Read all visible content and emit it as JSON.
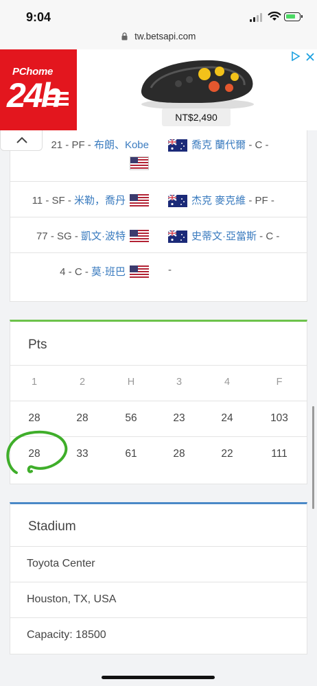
{
  "status": {
    "time": "9:04"
  },
  "browser": {
    "url": "tw.betsapi.com"
  },
  "ad": {
    "brand_top": "PChome",
    "brand_big": "24h",
    "price": "NT$2,490",
    "choices_icon": "ad-choices-icon",
    "close_icon": "close-icon"
  },
  "lineup": {
    "rows": [
      {
        "home_prefix": "21 - PF - ",
        "home_name": "布朗、Kobe",
        "away_name": "喬克 蘭代爾",
        "away_suffix": " - C -"
      },
      {
        "home_prefix": "11 - SF - ",
        "home_name": "米勒，喬丹",
        "away_name": "杰克 麥克維",
        "away_suffix": " - PF -"
      },
      {
        "home_prefix": "77 - SG - ",
        "home_name": "凱文·波特",
        "away_name": "史蒂文·亞當斯",
        "away_suffix": " - C -"
      },
      {
        "home_prefix": "4 - C - ",
        "home_name": "莫·班巴",
        "away_name": "",
        "away_suffix": "-"
      }
    ]
  },
  "points": {
    "title": "Pts",
    "headers": [
      "1",
      "2",
      "H",
      "3",
      "4",
      "F"
    ],
    "rows": [
      [
        "28",
        "28",
        "56",
        "23",
        "24",
        "103"
      ],
      [
        "28",
        "33",
        "61",
        "28",
        "22",
        "111"
      ]
    ],
    "highlight_color": "#3fae2a"
  },
  "stadium": {
    "title": "Stadium",
    "rows": [
      "Toyota Center",
      "Houston, TX, USA",
      "Capacity: 18500"
    ]
  },
  "colors": {
    "pts_accent": "#6cc24a",
    "stadium_accent": "#4a88c7",
    "link": "#3a7bbf"
  }
}
